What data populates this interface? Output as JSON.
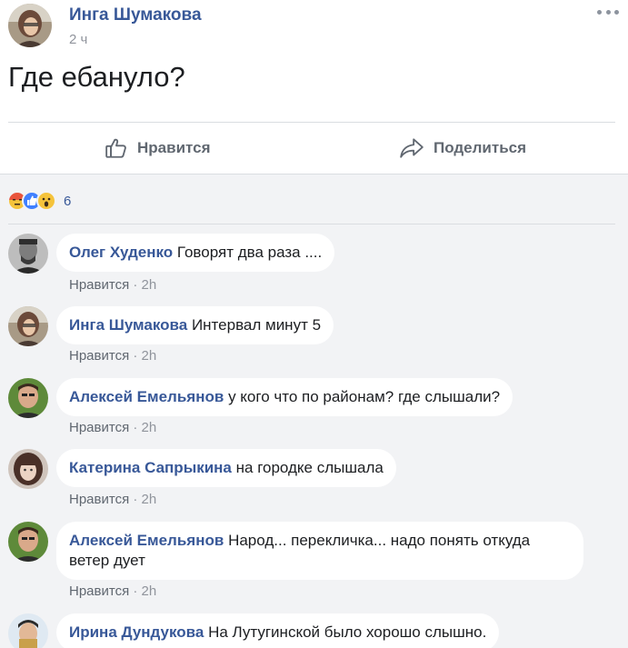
{
  "post": {
    "author": "Инга Шумакова",
    "time": "2 ч",
    "text": "Где ебануло?"
  },
  "actions": {
    "like_label": "Нравится",
    "share_label": "Поделиться"
  },
  "reactions": {
    "icons": [
      "angry-reaction-icon",
      "like-reaction-icon",
      "wow-reaction-icon"
    ],
    "count": "6"
  },
  "comments": [
    {
      "author": "Олег Худенко",
      "text": "Говорят два раза ....",
      "like_label": "Нравится",
      "separator": "·",
      "time": "2h"
    },
    {
      "author": "Инга Шумакова",
      "text": "Интервал минут 5",
      "like_label": "Нравится",
      "separator": "·",
      "time": "2h"
    },
    {
      "author": "Алексей Емельянов",
      "text": "у кого что по районам? где слышали?",
      "like_label": "Нравится",
      "separator": "·",
      "time": "2h"
    },
    {
      "author": "Катерина Сапрыкина",
      "text": "на городке слышала",
      "like_label": "Нравится",
      "separator": "·",
      "time": "2h"
    },
    {
      "author": "Алексей Емельянов",
      "text": "Народ... перекличка... надо понять откуда ветер дует",
      "like_label": "Нравится",
      "separator": "·",
      "time": "2h"
    },
    {
      "author": "Ирина Дундукова",
      "text": "На Лутугинской было хорошо слышно.",
      "like_label": "",
      "separator": "",
      "time": ""
    }
  ],
  "colors": {
    "link": "#385898",
    "meta": "#90949c",
    "comments_bg": "#f2f3f5"
  }
}
